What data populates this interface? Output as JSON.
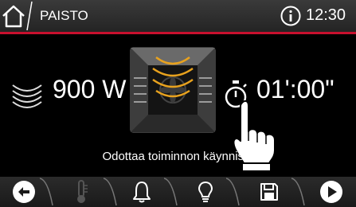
{
  "header": {
    "title": "PAISTO",
    "time": "12:30",
    "icons": {
      "home": "home-icon",
      "info": "info-icon"
    }
  },
  "main": {
    "power_value": "900 W",
    "timer_value": "01':00\"",
    "status_text": "Odottaa toiminnon käynnistä",
    "icons": {
      "power": "microwave-wave-icon",
      "oven": "oven-grill-icon",
      "timer": "timer-icon",
      "hand": "pointing-hand-icon"
    }
  },
  "footer": {
    "buttons": [
      {
        "name": "back",
        "icon": "back-arrow-icon",
        "enabled": true
      },
      {
        "name": "temperature",
        "icon": "thermometer-icon",
        "enabled": false
      },
      {
        "name": "alarm",
        "icon": "bell-icon",
        "enabled": true
      },
      {
        "name": "light",
        "icon": "lightbulb-icon",
        "enabled": true
      },
      {
        "name": "save",
        "icon": "save-icon",
        "enabled": true
      },
      {
        "name": "start",
        "icon": "play-icon",
        "enabled": true
      }
    ]
  },
  "colors": {
    "accent_red": "#c8102e",
    "accent_amber": "#e8a21e",
    "background": "#000000"
  }
}
